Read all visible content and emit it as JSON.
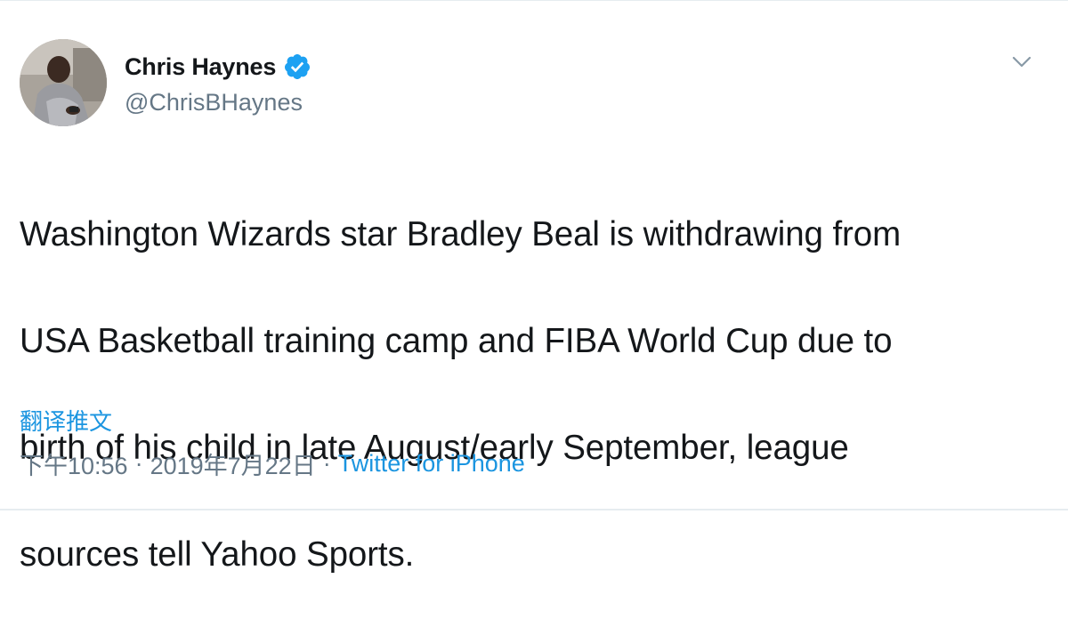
{
  "tweet": {
    "author": {
      "display_name": "Chris Haynes",
      "username": "@ChrisBHaynes",
      "verified": true,
      "avatar_icon": "user-avatar-photo"
    },
    "text_lines": [
      "Washington Wizards star Bradley Beal is withdrawing from",
      "USA Basketball training camp and FIBA World Cup due to",
      "birth of his child in late August/early September, league",
      "sources tell Yahoo Sports."
    ],
    "translate_label": "翻译推文",
    "time": "下午10:56",
    "separator": "·",
    "date": "2019年7月22日",
    "source": "Twitter for iPhone",
    "menu_icon": "chevron-down-icon"
  },
  "colors": {
    "link": "#1b95e0",
    "verified": "#1da1f2",
    "secondary_text": "#657786",
    "primary_text": "#14171a",
    "border": "#e6ecf0"
  }
}
